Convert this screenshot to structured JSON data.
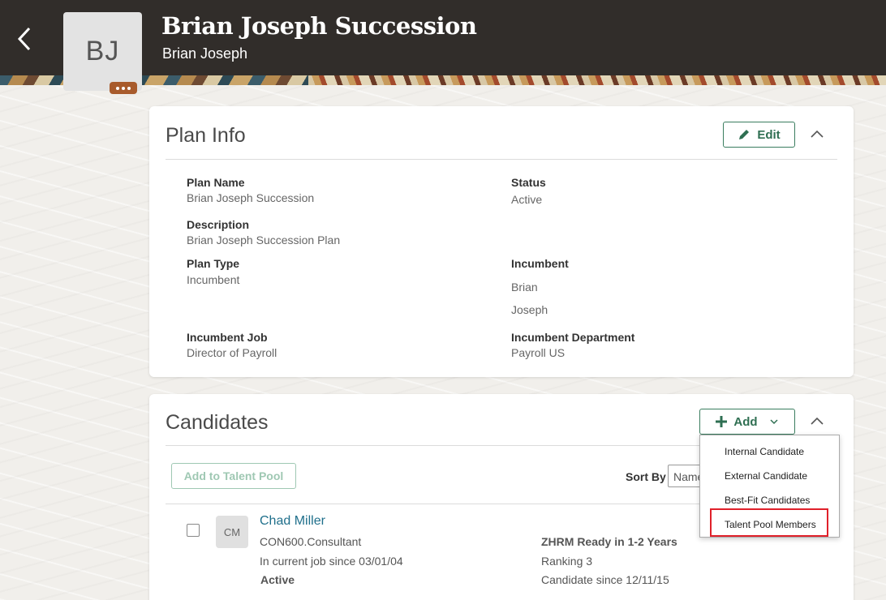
{
  "header": {
    "title": "Brian Joseph Succession",
    "subtitle": "Brian Joseph",
    "avatar_initials": "BJ",
    "icons": {
      "back": "chevron-left-icon",
      "more": "ellipsis-icon"
    }
  },
  "plan_info": {
    "title": "Plan Info",
    "edit_label": "Edit",
    "fields": {
      "plan_name": {
        "label": "Plan Name",
        "value": "Brian Joseph Succession"
      },
      "status": {
        "label": "Status",
        "value": "Active"
      },
      "description": {
        "label": "Description",
        "value": "Brian Joseph Succession Plan"
      },
      "plan_type": {
        "label": "Plan Type",
        "value": "Incumbent"
      },
      "incumbent": {
        "label": "Incumbent",
        "first": "Brian",
        "last": "Joseph"
      },
      "incumbent_job": {
        "label": "Incumbent Job",
        "value": "Director of Payroll"
      },
      "incumbent_department": {
        "label": "Incumbent Department",
        "value": "Payroll US"
      }
    }
  },
  "candidates": {
    "title": "Candidates",
    "add_label": "Add",
    "add_to_pool_label": "Add to Talent Pool",
    "sort_by_label": "Sort By",
    "sort_value": "Name",
    "add_menu": [
      "Internal Candidate",
      "External Candidate",
      "Best-Fit Candidates",
      "Talent Pool Members"
    ],
    "items": [
      {
        "initials": "CM",
        "name": "Chad Miller",
        "job": "CON600.Consultant",
        "since_job": "In current job since 03/01/04",
        "status": "Active",
        "readiness": "ZHRM Ready in 1-2 Years",
        "ranking": "Ranking 3",
        "candidate_since": "Candidate since 12/11/15"
      }
    ]
  },
  "colors": {
    "accent": "#2f6f52",
    "link": "#1f6f8b",
    "header_bg": "#312d2a",
    "highlight": "#e0202a"
  }
}
